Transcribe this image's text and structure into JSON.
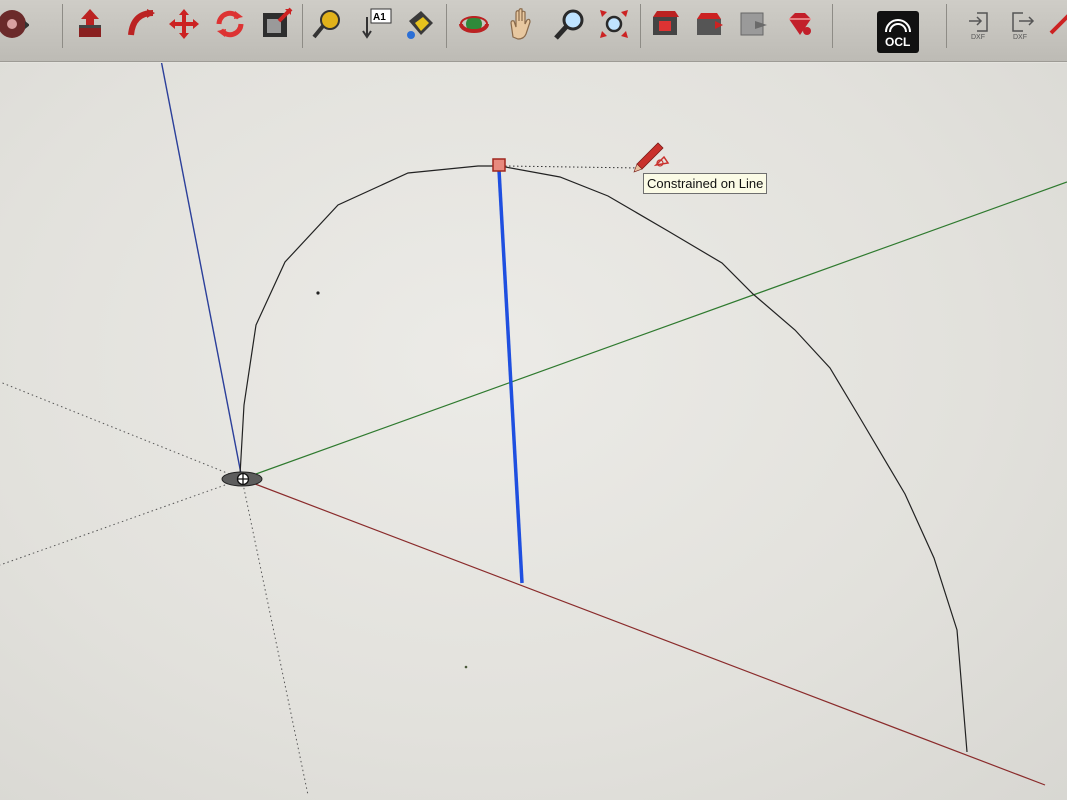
{
  "tooltip": {
    "text": "Constrained on Line"
  },
  "toolbar": {
    "text_tool_label": "A1",
    "ocl_label": "OCL",
    "export_dxf_1": "DXF",
    "export_dxf_2": "DXF"
  },
  "colors": {
    "red_axis": "#8a2b2b",
    "green_axis": "#2f7a2f",
    "blue_axis": "#2b3f9a",
    "blue_edge": "#1f4fe0",
    "arc": "#222222",
    "endpoint_marker": "#d9534f"
  },
  "icons": [
    "orbit-disc-icon",
    "push-pull-icon",
    "follow-me-icon",
    "move-icon",
    "rotate-icon",
    "scale-icon",
    "tape-measure-icon",
    "text-icon",
    "paint-bucket-icon",
    "orbit-icon",
    "pan-hand-icon",
    "zoom-icon",
    "zoom-extents-icon",
    "warehouse-icon",
    "share-model-icon",
    "extension-warehouse-icon",
    "ruby-console-icon",
    "ocl-icon",
    "import-dxf-icon",
    "export-dxf-icon",
    "pencil-icon"
  ]
}
